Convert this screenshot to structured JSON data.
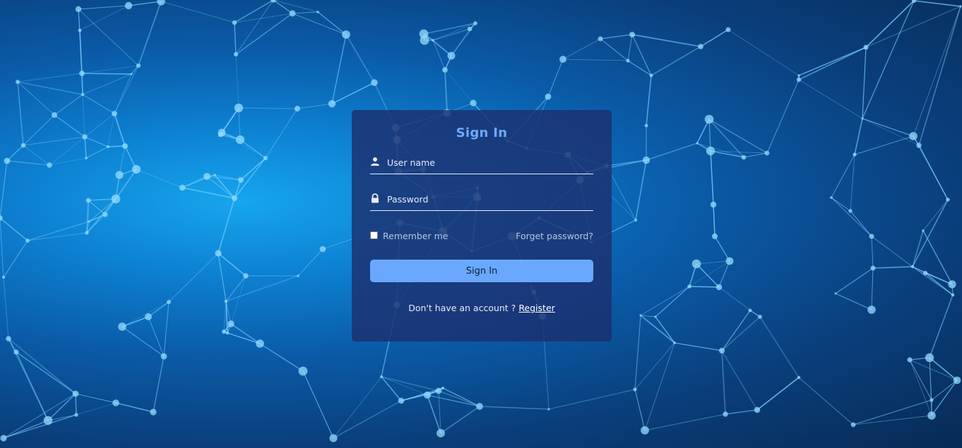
{
  "login": {
    "title": "Sign In",
    "username_placeholder": "User name",
    "password_placeholder": "Password",
    "remember_label": "Remember me",
    "forgot_label": "Forget password?",
    "submit_label": "Sign In",
    "no_account_text": "Don't have an account ?",
    "register_label": "Register"
  },
  "colors": {
    "accent": "#6aa8ff",
    "title": "#6fa8ff",
    "card": "#1c306e"
  },
  "icons": {
    "username": "user-icon",
    "password": "lock-icon"
  }
}
